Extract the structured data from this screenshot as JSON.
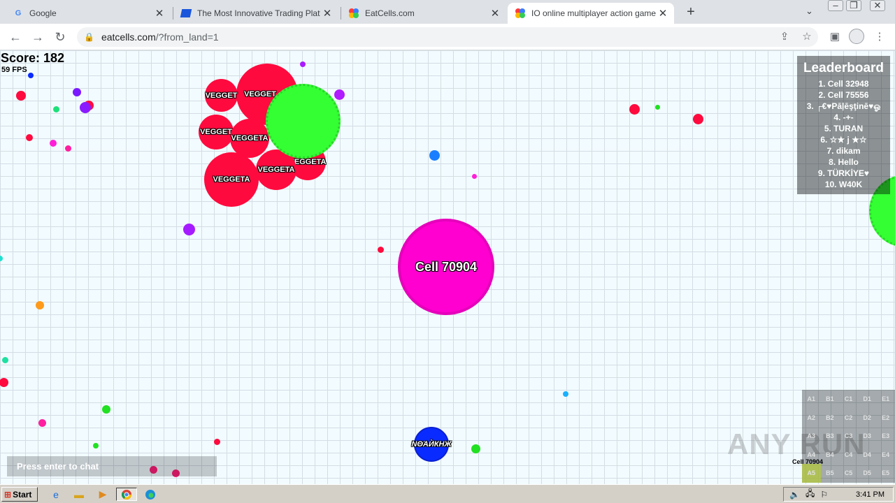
{
  "browser": {
    "tabs": [
      {
        "title": "Google",
        "favicon": "google-icon"
      },
      {
        "title": "The Most Innovative Trading Platform",
        "favicon": "trading-icon"
      },
      {
        "title": "EatCells.com",
        "favicon": "eatcells-icon"
      },
      {
        "title": "IO online multiplayer action game. St",
        "favicon": "eatcells-icon",
        "active": true
      }
    ],
    "url_host": "eatcells.com",
    "url_path": "/?from_land=1"
  },
  "game": {
    "score": "Score: 182",
    "fps": "59 FPS",
    "leaderboard": {
      "title": "Leaderboard",
      "entries": [
        "1. Cell 32948",
        "2. Cell 75556",
        "3. ┌€♥Pāļēşţinē♥ஓ",
        "4. -+-",
        "5. TURAN",
        "6. ⁪☆★ j ★☆⁪",
        "7. dikam",
        "8. Hello",
        "9. TÜRKİYE♥",
        "10. W40K"
      ]
    },
    "players": {
      "main": "Cell 70904",
      "vegget_1": "VEGGET",
      "vegget_2": "VEGGET",
      "vegget_3": "VEGGET",
      "veggeta_1": "VEGGETA",
      "veggeta_2": "VEGGETA",
      "veggeta_3": "VEGGETA",
      "veggeta_4": "VEGGETA",
      "blue": "ΝΘΆЍКНЖ"
    },
    "chat_placeholder": "Press enter to chat",
    "minimap": {
      "rows": [
        [
          "A1",
          "B1",
          "C1",
          "D1",
          "E1"
        ],
        [
          "A2",
          "B2",
          "C2",
          "D2",
          "E2"
        ],
        [
          "A3",
          "B3",
          "C3",
          "D3",
          "E3"
        ],
        [
          "A4",
          "B4",
          "C4",
          "D4",
          "E4"
        ],
        [
          "A5",
          "B5",
          "C5",
          "D5",
          "E5"
        ]
      ],
      "current_sector": "A5",
      "player_label": "Cell 70904"
    },
    "colors": {
      "player": "#ff00d0",
      "enemy": "#ff0a3e",
      "virus": "#33ff33",
      "blue_player": "#0a2bff",
      "grid_bg": "#f2fbff"
    }
  },
  "watermark": "ANY RUN",
  "taskbar": {
    "start_label": "Start",
    "clock": "3:41 PM"
  }
}
